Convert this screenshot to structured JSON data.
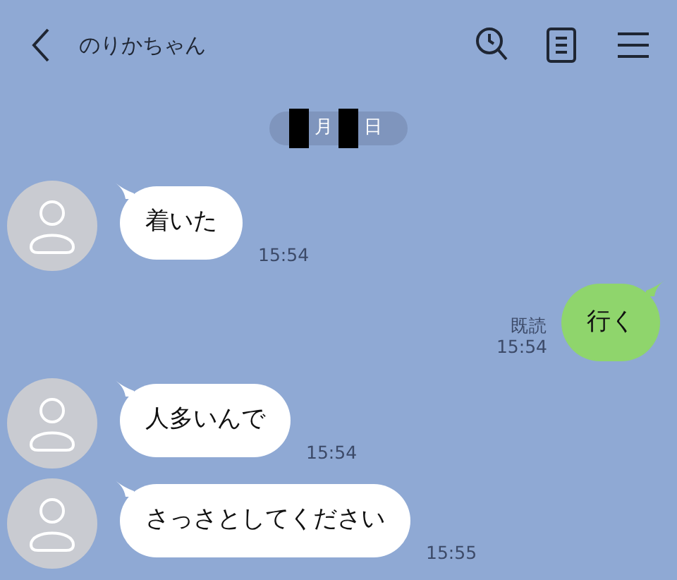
{
  "header": {
    "title": "のりかちゃん"
  },
  "date": [
    {
      "kind": "redacted"
    },
    {
      "kind": "text",
      "text": "月"
    },
    {
      "kind": "redacted"
    },
    {
      "kind": "text",
      "text": "日"
    }
  ],
  "messages": [
    {
      "kind": "incoming",
      "text": "着いた",
      "time": "15:54"
    },
    {
      "kind": "outgoing",
      "text": "行く",
      "time": "15:54",
      "read": "既読"
    },
    {
      "kind": "incoming",
      "text": "人多いんで",
      "time": "15:54"
    },
    {
      "kind": "incoming",
      "text": "さっさとしてください",
      "time": "15:55"
    }
  ]
}
